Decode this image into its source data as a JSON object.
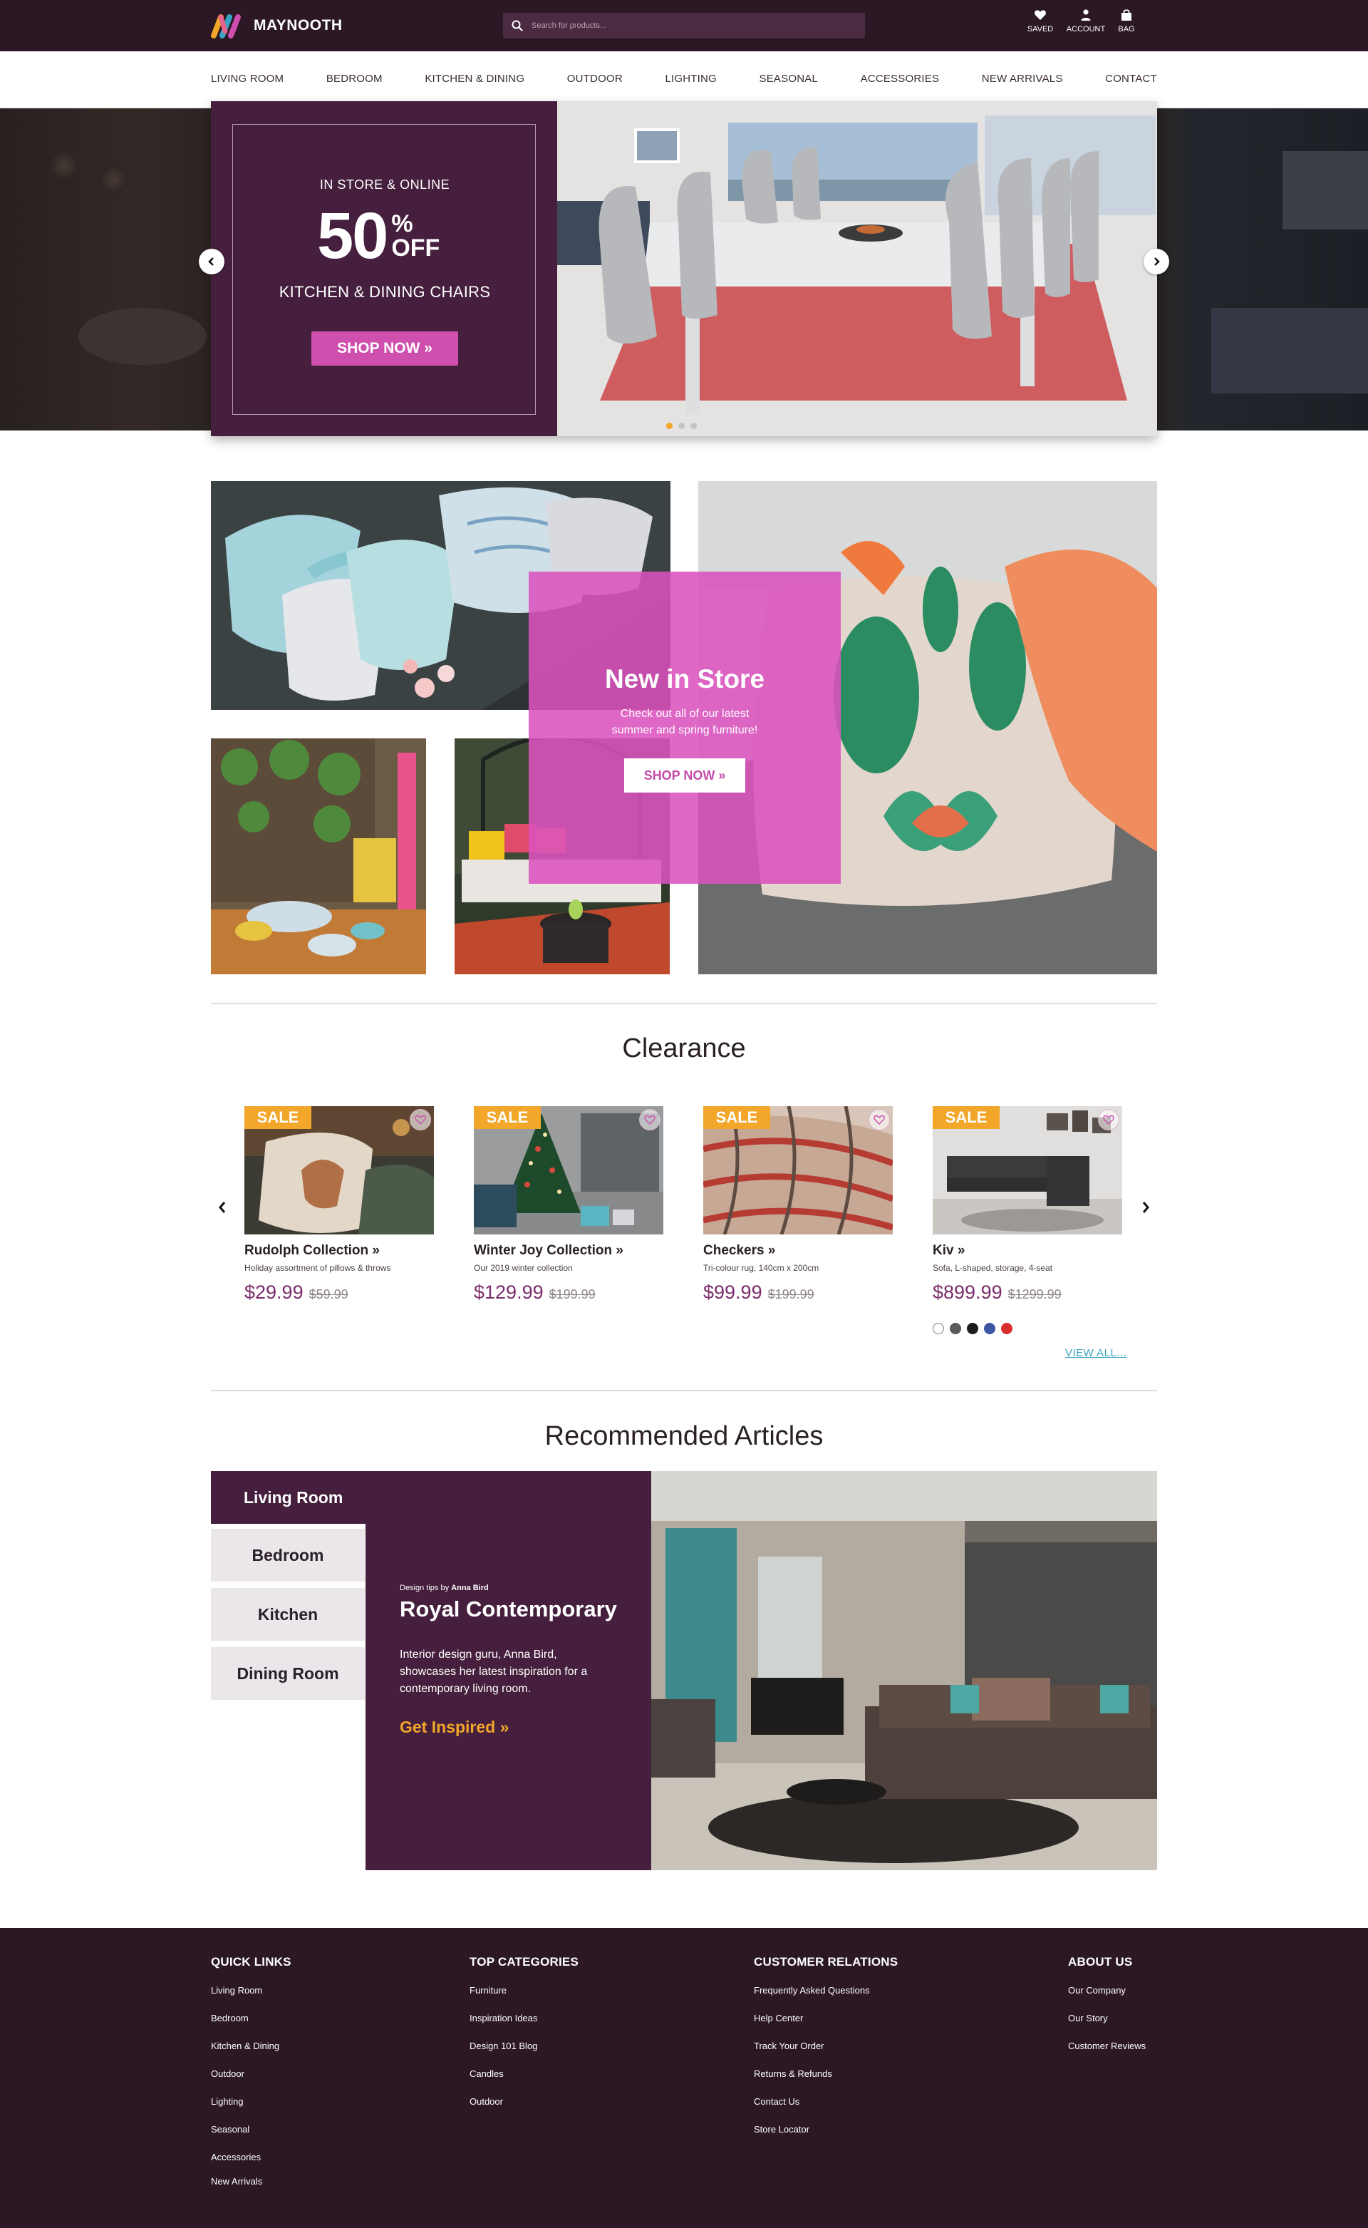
{
  "brand": {
    "name": "MAYNOOTH"
  },
  "search": {
    "placeholder": "Search for products..."
  },
  "top_actions": [
    {
      "label": "SAVED",
      "icon": "heart-icon"
    },
    {
      "label": "ACCOUNT",
      "icon": "user-icon"
    },
    {
      "label": "BAG",
      "icon": "bag-icon"
    }
  ],
  "nav": [
    "LIVING ROOM",
    "BEDROOM",
    "KITCHEN & DINING",
    "OUTDOOR",
    "LIGHTING",
    "SEASONAL",
    "ACCESSORIES",
    "NEW ARRIVALS",
    "CONTACT"
  ],
  "hero": {
    "pre": "IN STORE & ONLINE",
    "number": "50",
    "percent": "%",
    "off": "OFF",
    "subtitle": "KITCHEN & DINING CHAIRS",
    "cta": "SHOP NOW  »",
    "slides": 3,
    "active_slide": 1
  },
  "new_in_store": {
    "title": "New in Store",
    "text": "Check out all of our latest summer and spring furniture!",
    "cta": "SHOP NOW  »"
  },
  "clearance": {
    "title": "Clearance",
    "sale_label": "SALE",
    "view_all": "VIEW ALL...",
    "products": [
      {
        "name": "Rudolph Collection »",
        "desc": "Holiday assortment of pillows & throws",
        "price": "$29.99",
        "was": "$59.99"
      },
      {
        "name": "Winter Joy Collection »",
        "desc": "Our 2019 winter collection",
        "price": "$129.99",
        "was": "$199.99"
      },
      {
        "name": "Checkers »",
        "desc": "Tri-colour rug, 140cm x 200cm",
        "price": "$99.99",
        "was": "$199.99"
      },
      {
        "name": "Kiv »",
        "desc": "Sofa, L-shaped, storage, 4-seat",
        "price": "$899.99",
        "was": "$1299.99"
      }
    ],
    "swatch_colors": [
      "#ffffff",
      "#5a5a5a",
      "#1c1c1c",
      "#3d55a5",
      "#d9302f"
    ]
  },
  "articles": {
    "title": "Recommended Articles",
    "tabs": [
      "Living Room",
      "Bedroom",
      "Kitchen",
      "Dining Room"
    ],
    "active_tab": "Living Room",
    "kicker_prefix": "Design tips by",
    "kicker_author": "Anna Bird",
    "headline": "Royal Contemporary",
    "body": "Interior design guru, Anna Bird, showcases her latest inspiration for a contemporary living room.",
    "cta": "Get Inspired »"
  },
  "footer": {
    "columns": [
      {
        "title": "QUICK LINKS",
        "links": [
          "Living Room",
          "Bedroom",
          "Kitchen & Dining",
          "Outdoor",
          "Lighting",
          "Seasonal",
          "Accessories",
          "New Arrivals"
        ]
      },
      {
        "title": "TOP CATEGORIES",
        "links": [
          "Furniture",
          "Inspiration Ideas",
          "Design 101 Blog",
          "Candles",
          "Outdoor"
        ]
      },
      {
        "title": "CUSTOMER RELATIONS",
        "links": [
          "Frequently Asked Questions",
          "Help Center",
          "Track Your Order",
          "Returns & Refunds",
          "Contact Us",
          "Store Locator"
        ]
      },
      {
        "title": "ABOUT US",
        "links": [
          "Our Company",
          "Our Story",
          "Customer Reviews"
        ]
      }
    ]
  },
  "colors": {
    "primary": "#451f3d",
    "header": "#2b1824",
    "accent_pink": "#cf4fae",
    "accent_orange": "#f2a72a",
    "price": "#7c2d6a"
  }
}
